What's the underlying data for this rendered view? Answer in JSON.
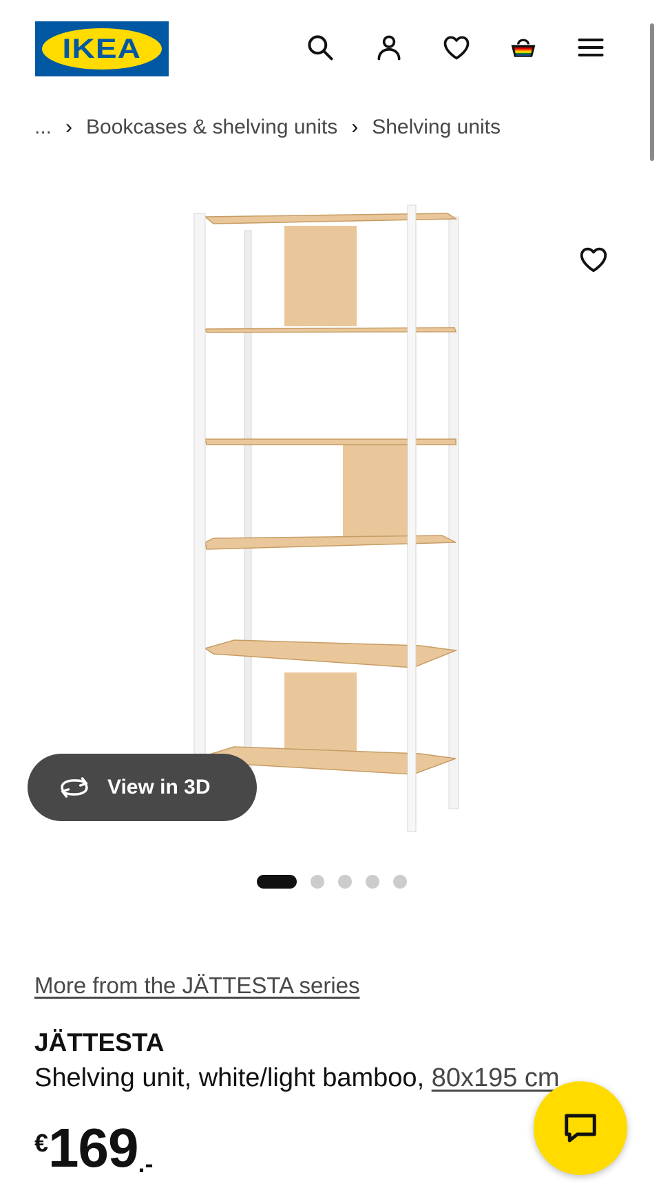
{
  "header": {
    "logo_text": "IKEA",
    "icons": [
      "search-icon",
      "user-icon",
      "heart-icon",
      "basket-icon",
      "menu-icon"
    ]
  },
  "breadcrumb": {
    "ellipsis": "...",
    "items": [
      "Bookcases & shelving units",
      "Shelving units"
    ]
  },
  "gallery": {
    "view_3d_label": "View in 3D",
    "image_count": 5,
    "active_index": 0
  },
  "product": {
    "series_link": "More from the JÄTTESTA series",
    "name": "JÄTTESTA",
    "description_prefix": "Shelving unit, white/light bamboo, ",
    "size": "80x195 cm",
    "price_currency": "€",
    "price_amount": "169",
    "price_suffix": ".-"
  },
  "colors": {
    "ikea_blue": "#0058a3",
    "ikea_yellow": "#ffdb00",
    "pill_bg": "#484848"
  }
}
